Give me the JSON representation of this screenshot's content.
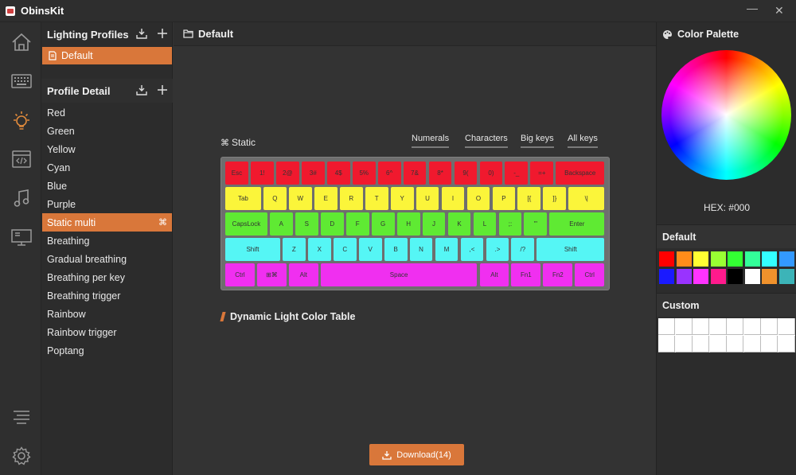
{
  "window": {
    "title": "ObinsKit",
    "minimize_glyph": "—",
    "close_glyph": "✕"
  },
  "rail": {
    "items": [
      {
        "name": "home-icon",
        "active": false
      },
      {
        "name": "keyboard-icon",
        "active": false
      },
      {
        "name": "lighting-icon",
        "active": true
      },
      {
        "name": "macro-icon",
        "active": false
      },
      {
        "name": "music-icon",
        "active": false
      },
      {
        "name": "monitor-icon",
        "active": false
      }
    ],
    "bottom": [
      {
        "name": "menu-lines-icon"
      },
      {
        "name": "settings-gear-icon"
      }
    ],
    "accent": "#d9773a"
  },
  "lighting_profiles": {
    "title": "Lighting Profiles",
    "items": [
      {
        "label": "Default",
        "active": true
      }
    ]
  },
  "profile_detail": {
    "title": "Profile Detail",
    "items": [
      {
        "label": "Red"
      },
      {
        "label": "Green"
      },
      {
        "label": "Yellow"
      },
      {
        "label": "Cyan"
      },
      {
        "label": "Blue"
      },
      {
        "label": "Purple"
      },
      {
        "label": "Static multi",
        "active": true
      },
      {
        "label": "Breathing"
      },
      {
        "label": "Gradual breathing"
      },
      {
        "label": "Breathing per key"
      },
      {
        "label": "Breathing trigger"
      },
      {
        "label": "Rainbow"
      },
      {
        "label": "Rainbow trigger"
      },
      {
        "label": "Poptang"
      }
    ]
  },
  "main": {
    "title": "Default",
    "mode_label": "Static",
    "filter_tabs": [
      "Numerals",
      "Characters",
      "Big keys",
      "All keys"
    ],
    "dynamic_title": "Dynamic Light Color Table",
    "download_label": "Download(14)"
  },
  "keyboard": {
    "colors": {
      "red": "#f0192e",
      "yellow": "#fbf53a",
      "green": "#5fea33",
      "cyan": "#55f6f5",
      "magenta": "#f02ff0"
    },
    "rows": [
      {
        "color": "red",
        "keys": [
          {
            "label": "Esc",
            "w": 1
          },
          {
            "label": "1!",
            "w": 1
          },
          {
            "label": "2@",
            "w": 1
          },
          {
            "label": "3#",
            "w": 1
          },
          {
            "label": "4$",
            "w": 1
          },
          {
            "label": "5%",
            "w": 1
          },
          {
            "label": "6^",
            "w": 1
          },
          {
            "label": "7&",
            "w": 1
          },
          {
            "label": "8*",
            "w": 1
          },
          {
            "label": "9(",
            "w": 1
          },
          {
            "label": "0)",
            "w": 1
          },
          {
            "label": "-_",
            "w": 1
          },
          {
            "label": "=+",
            "w": 1
          },
          {
            "label": "Backspace",
            "w": 2
          }
        ]
      },
      {
        "color": "yellow",
        "keys": [
          {
            "label": "Tab",
            "w": 1.5
          },
          {
            "label": "Q",
            "w": 1
          },
          {
            "label": "W",
            "w": 1
          },
          {
            "label": "E",
            "w": 1
          },
          {
            "label": "R",
            "w": 1
          },
          {
            "label": "T",
            "w": 1
          },
          {
            "label": "Y",
            "w": 1
          },
          {
            "label": "U",
            "w": 1
          },
          {
            "label": "I",
            "w": 1
          },
          {
            "label": "O",
            "w": 1
          },
          {
            "label": "P",
            "w": 1
          },
          {
            "label": "[{",
            "w": 1
          },
          {
            "label": "]}",
            "w": 1
          },
          {
            "label": "\\|",
            "w": 1.5
          }
        ]
      },
      {
        "color": "green",
        "keys": [
          {
            "label": "CapsLock",
            "w": 1.75
          },
          {
            "label": "A",
            "w": 1
          },
          {
            "label": "S",
            "w": 1
          },
          {
            "label": "D",
            "w": 1
          },
          {
            "label": "F",
            "w": 1
          },
          {
            "label": "G",
            "w": 1
          },
          {
            "label": "H",
            "w": 1
          },
          {
            "label": "J",
            "w": 1
          },
          {
            "label": "K",
            "w": 1
          },
          {
            "label": "L",
            "w": 1
          },
          {
            "label": ";:",
            "w": 1
          },
          {
            "label": "'\"",
            "w": 1
          },
          {
            "label": "Enter",
            "w": 2.25
          }
        ]
      },
      {
        "color": "cyan",
        "keys": [
          {
            "label": "Shift",
            "w": 2.25
          },
          {
            "label": "Z",
            "w": 1
          },
          {
            "label": "X",
            "w": 1
          },
          {
            "label": "C",
            "w": 1
          },
          {
            "label": "V",
            "w": 1
          },
          {
            "label": "B",
            "w": 1
          },
          {
            "label": "N",
            "w": 1
          },
          {
            "label": "M",
            "w": 1
          },
          {
            "label": ",<",
            "w": 1
          },
          {
            "label": ".>",
            "w": 1
          },
          {
            "label": "/?",
            "w": 1
          },
          {
            "label": "Shift",
            "w": 2.75
          }
        ]
      },
      {
        "color": "magenta",
        "keys": [
          {
            "label": "Ctrl",
            "w": 1.25
          },
          {
            "label": "⊞⌘",
            "w": 1.25
          },
          {
            "label": "Alt",
            "w": 1.25
          },
          {
            "label": "Space",
            "w": 6.25
          },
          {
            "label": "Alt",
            "w": 1.25
          },
          {
            "label": "Fn1",
            "w": 1.25
          },
          {
            "label": "Fn2",
            "w": 1.25
          },
          {
            "label": "Ctrl",
            "w": 1.25
          }
        ]
      }
    ]
  },
  "palette": {
    "title": "Color Palette",
    "hex_label": "HEX: #000",
    "default_title": "Default",
    "default_swatches": [
      "#ff0000",
      "#ff8c1a",
      "#ffff33",
      "#99ff33",
      "#33ff33",
      "#33ff99",
      "#33ffff",
      "#3399ff",
      "#1a1aff",
      "#9933ff",
      "#ff33ff",
      "#ff1a8c",
      "#000000",
      "#ffffff",
      "#f0922c",
      "#3cb4b8"
    ],
    "custom_title": "Custom",
    "custom_swatches": [
      "#ffffff",
      "#ffffff",
      "#ffffff",
      "#ffffff",
      "#ffffff",
      "#ffffff",
      "#ffffff",
      "#ffffff",
      "#ffffff",
      "#ffffff",
      "#ffffff",
      "#ffffff",
      "#ffffff",
      "#ffffff",
      "#ffffff",
      "#ffffff"
    ]
  }
}
